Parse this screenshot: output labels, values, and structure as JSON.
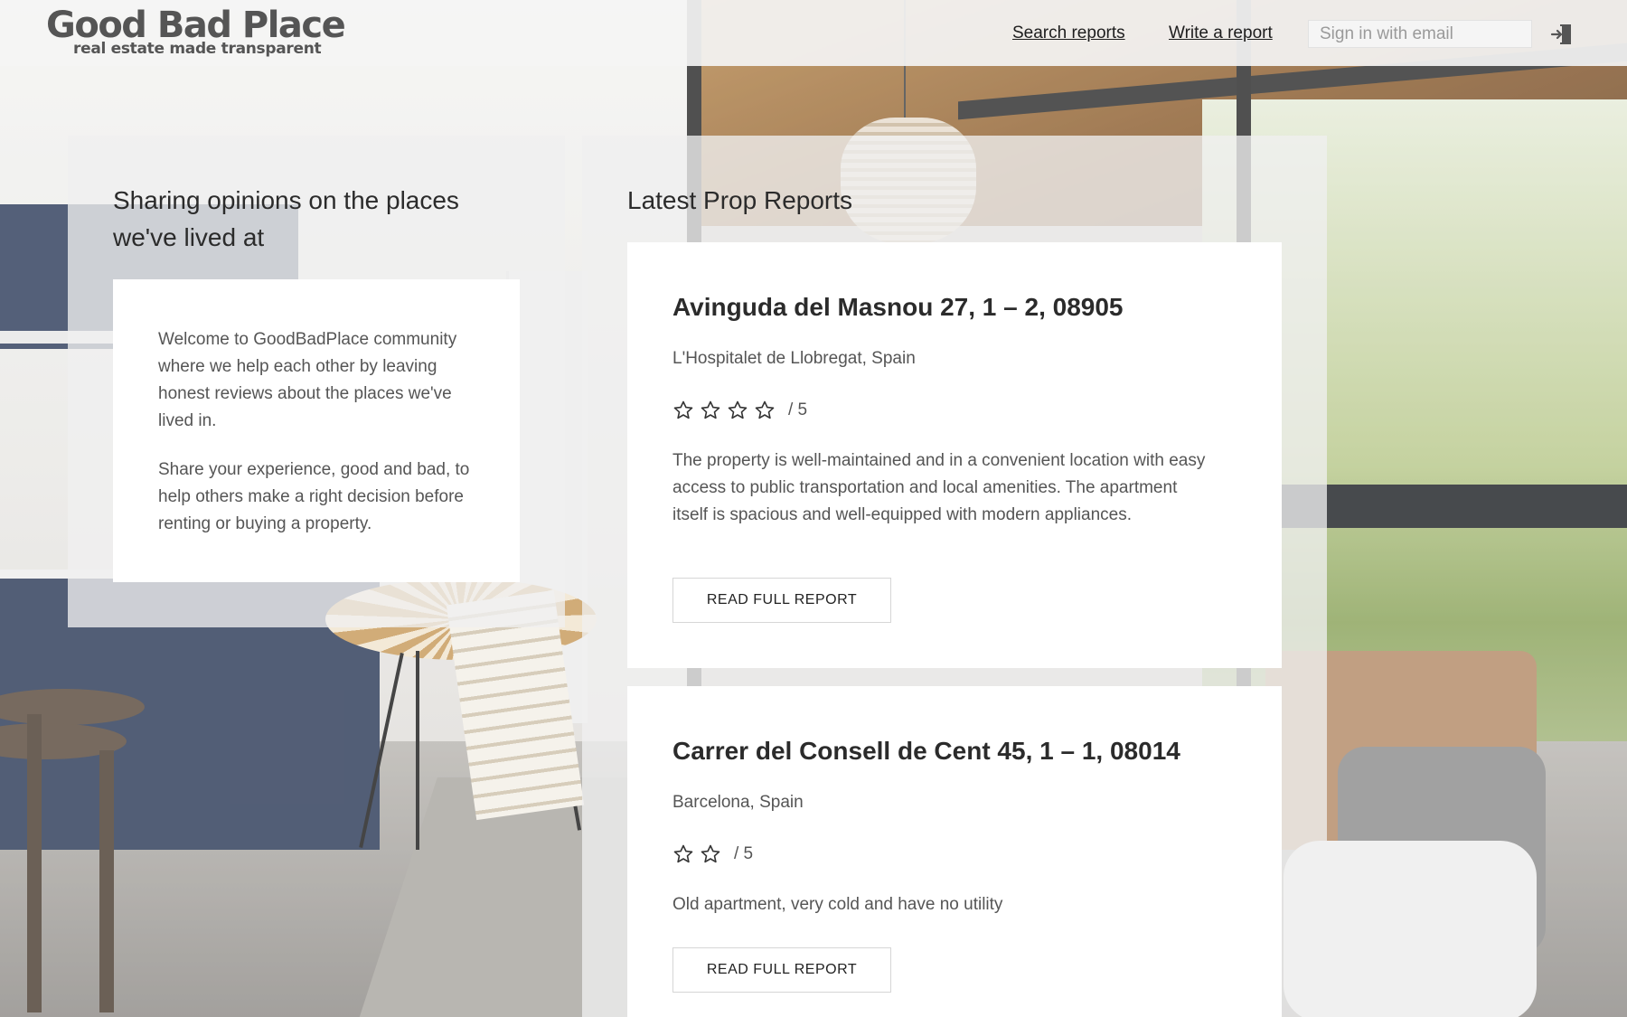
{
  "header": {
    "logo_title": "Good Bad Place",
    "logo_tagline": "real estate made transparent",
    "nav": {
      "search_reports": "Search reports",
      "write_report": "Write a report"
    },
    "email_placeholder": "Sign in with email",
    "signin_icon": "sign-in-door-icon"
  },
  "intro": {
    "heading": "Sharing opinions on the places we've lived at",
    "paragraph_1": "Welcome to GoodBadPlace community where we help each other by leaving honest reviews about the places we've lived in.",
    "paragraph_2": "Share your experience, good and bad, to help others make a right decision before renting or buying a property."
  },
  "reports": {
    "heading": "Latest Prop Reports",
    "button_label": "READ FULL REPORT",
    "items": [
      {
        "address": "Avinguda del Masnou 27, 1 – 2, 08905",
        "city": "L'Hospitalet de Llobregat, Spain",
        "stars": 4,
        "rating_total": "/ 5",
        "description": "The property is well-maintained and in a convenient location with easy access to public transportation and local amenities. The apartment itself is spacious and well-equipped with modern appliances."
      },
      {
        "address": "Carrer del Consell de Cent 45, 1 – 1, 08014",
        "city": "Barcelona, Spain",
        "stars": 2,
        "rating_total": "/ 5",
        "description": "Old apartment, very cold and have no utility"
      }
    ]
  },
  "colors": {
    "header_bg": "#f4f4f4",
    "panel_bg": "#f0f0f0",
    "card_bg": "#ffffff",
    "text_dark": "#2b2b2b",
    "text_muted": "#555555"
  }
}
